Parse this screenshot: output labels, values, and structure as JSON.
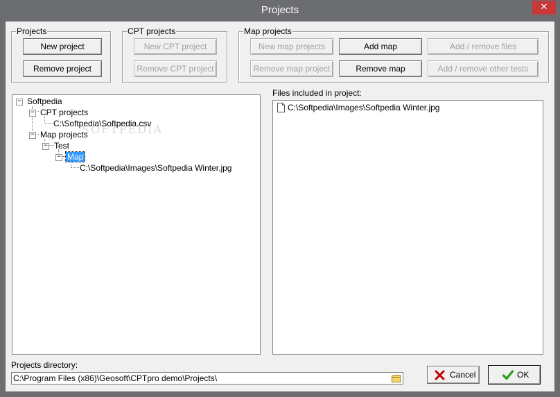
{
  "window": {
    "title": "Projects",
    "close_label": "✕"
  },
  "projects_group": {
    "label": "Projects",
    "new_label": "New project",
    "remove_label": "Remove project"
  },
  "cpt_group": {
    "label": "CPT projects",
    "new_label": "New CPT project",
    "remove_label": "Remove CPT project"
  },
  "map_group": {
    "label": "Map projects",
    "new_label": "New map projects",
    "remove_label": "Remove map project",
    "add_map_label": "Add map",
    "remove_map_label": "Remove map",
    "add_remove_files_label": "Add / remove files",
    "add_remove_tests_label": "Add / remove other tests"
  },
  "tree": {
    "root": "Softpedia",
    "cpt_projects": "CPT projects",
    "cpt_file": "C:\\Softpedia\\Softpedia.csv",
    "map_projects": "Map projects",
    "test": "Test",
    "map": "Map",
    "map_file": "C:\\Softpedia\\Images\\Softpedia Winter.jpg"
  },
  "files_panel": {
    "label": "Files included in project:",
    "files": [
      "C:\\Softpedia\\Images\\Softpedia Winter.jpg"
    ]
  },
  "directory": {
    "label": "Projects directory:",
    "value": "C:\\Program Files (x86)\\Geosoft\\CPTpro demo\\Projects\\"
  },
  "buttons": {
    "cancel_label": "Cancel",
    "ok_label": "OK"
  },
  "colors": {
    "titlebar": "#6b6d71",
    "selection": "#3399ff",
    "close": "#c7383a",
    "cancel_icon": "#c00000",
    "ok_icon": "#2a9d1a"
  }
}
